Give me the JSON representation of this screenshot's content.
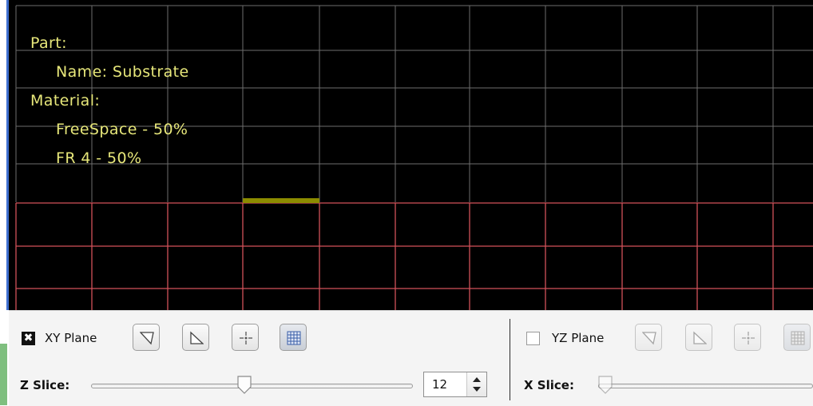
{
  "part_info": {
    "part_heading": "Part:",
    "name_line": "Name: Substrate",
    "material_heading": "Material:",
    "materials": [
      "FreeSpace - 50%",
      "FR 4 - 50%"
    ]
  },
  "colors": {
    "info_text": "#e7e77a",
    "grid_upper": "#707070",
    "grid_lower": "#d2525a",
    "substrate_edge": "#8c8c00"
  },
  "xy_panel": {
    "checkbox_checked": true,
    "plane_label": "XY Plane",
    "slice_label": "Z Slice:",
    "slice_value": "12",
    "buttons": [
      "view-diagonal-icon",
      "view-corner-icon",
      "center-point-icon",
      "grid-toggle-icon"
    ]
  },
  "yz_panel": {
    "checkbox_checked": false,
    "plane_label": "YZ Plane",
    "slice_label": "X Slice:",
    "buttons": [
      "view-diagonal-icon",
      "view-corner-icon",
      "center-point-icon",
      "grid-toggle-icon"
    ]
  }
}
